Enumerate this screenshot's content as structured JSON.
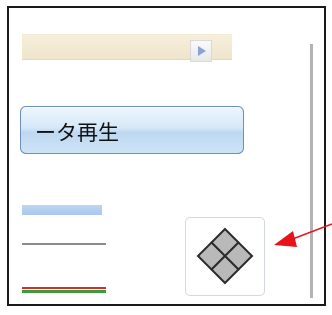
{
  "play_button": {
    "label": "ータ再生"
  },
  "combo": {
    "arrow_icon": "triangle-right-icon"
  },
  "diamond_button": {
    "icon": "four-diamond-icon"
  },
  "colors": {
    "combo_bg": "#f0e6cd",
    "button_blue": "#cfe3f6",
    "button_border": "#6c8fbf",
    "line_blue": "#b2cff1",
    "line_gray": "#8a8a8a",
    "line_red": "#d42d2d",
    "line_green": "#3f9b3a",
    "annotation_red": "#e8121b",
    "diamond_fill": "#b8b8b8"
  }
}
